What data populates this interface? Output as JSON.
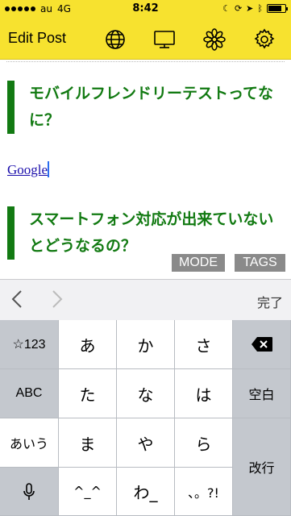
{
  "status_bar": {
    "carrier": "au",
    "network": "4G",
    "time": "8:42",
    "battery_percent": 80
  },
  "nav": {
    "title": "Edit Post",
    "icons": [
      "globe-icon",
      "monitor-icon",
      "flower-icon",
      "gear-icon"
    ]
  },
  "post": {
    "heading1": "モバイルフレンドリーテストってなに？",
    "link_text": "Google",
    "heading2": "スマートフォン対応が出来ていないとどうなるの？",
    "mode_label": "MODE",
    "tags_label": "TAGS"
  },
  "accessory": {
    "prev_label": "〈",
    "next_label": "〉",
    "done_label": "完了"
  },
  "keyboard": {
    "left_column": [
      "☆123",
      "ABC",
      "あいう",
      "mic-icon"
    ],
    "rows": [
      [
        "あ",
        "か",
        "さ"
      ],
      [
        "た",
        "な",
        "は"
      ],
      [
        "ま",
        "や",
        "ら"
      ],
      [
        "^_^",
        "わ_",
        "、。?!"
      ]
    ],
    "right_column": [
      "delete-icon",
      "空白",
      "改行"
    ]
  },
  "colors": {
    "accent_yellow": "#f7e22f",
    "heading_green": "#127a12",
    "button_gray": "#8a8a8a",
    "link_blue": "#1a0dab"
  }
}
